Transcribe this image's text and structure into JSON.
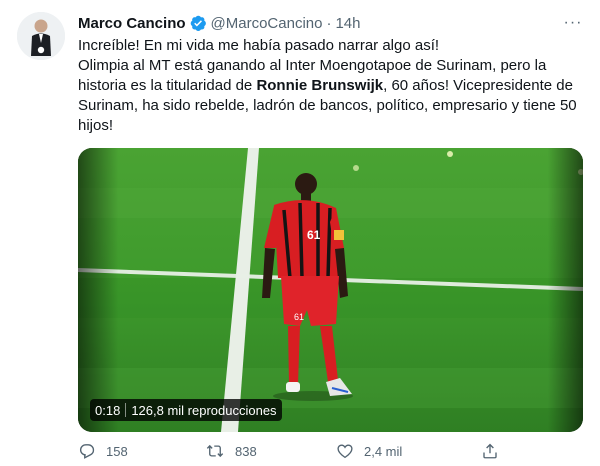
{
  "author": {
    "name": "Marco Cancino",
    "handle": "@MarcoCancino",
    "time": "14h",
    "verified": true
  },
  "more_label": "···",
  "tweet": {
    "line1": "Increíble! En mi vida me había pasado narrar algo así!",
    "line2_pre": "Olimpia al MT está ganando al Inter Moengotapoe de Surinam, pero la historia es la titularidad de ",
    "line2_bold": "Ronnie Brunswijk",
    "line2_post": ", 60 años! Vicepresidente de Surinam, ha sido rebelde, ladrón de bancos, político, empresario y tiene 50 hijos!"
  },
  "video": {
    "duration": "0:18",
    "views": "126,8 mil reproducciones",
    "jersey_number": "61",
    "shorts_number": "61"
  },
  "actions": {
    "replies": "158",
    "retweets": "838",
    "likes": "2,4 mil"
  },
  "colors": {
    "text": "#0f1419",
    "secondary": "#536471",
    "verified": "#1d9bf0",
    "pitch": "#3f9a2e",
    "jersey": "#d81e22"
  },
  "icons": [
    "verified-badge-icon",
    "more-icon",
    "reply-icon",
    "retweet-icon",
    "like-icon",
    "share-icon"
  ]
}
